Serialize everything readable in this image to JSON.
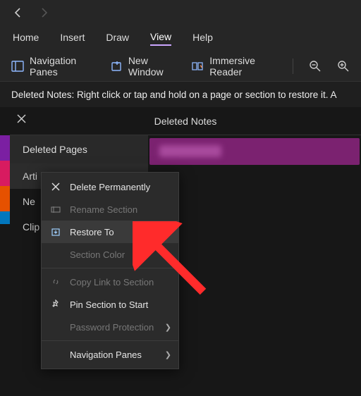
{
  "menubar": {
    "home": "Home",
    "insert": "Insert",
    "draw": "Draw",
    "view": "View",
    "help": "Help"
  },
  "toolbar": {
    "nav_panes": "Navigation Panes",
    "new_window": "New Window",
    "immersive": "Immersive Reader"
  },
  "infobar": {
    "text": "Deleted Notes: Right click or tap and hold on a page or section to restore it. A"
  },
  "pane": {
    "title": "Deleted Notes",
    "header": "Deleted Pages"
  },
  "sidebar": {
    "items": [
      "Arti",
      "Ne",
      "Clip"
    ]
  },
  "ctx": {
    "delete": "Delete Permanently",
    "rename": "Rename Section",
    "restore": "Restore To",
    "color": "Section Color",
    "copylink": "Copy Link to Section",
    "pin": "Pin Section to Start",
    "password": "Password Protection",
    "navpanes": "Navigation Panes"
  }
}
